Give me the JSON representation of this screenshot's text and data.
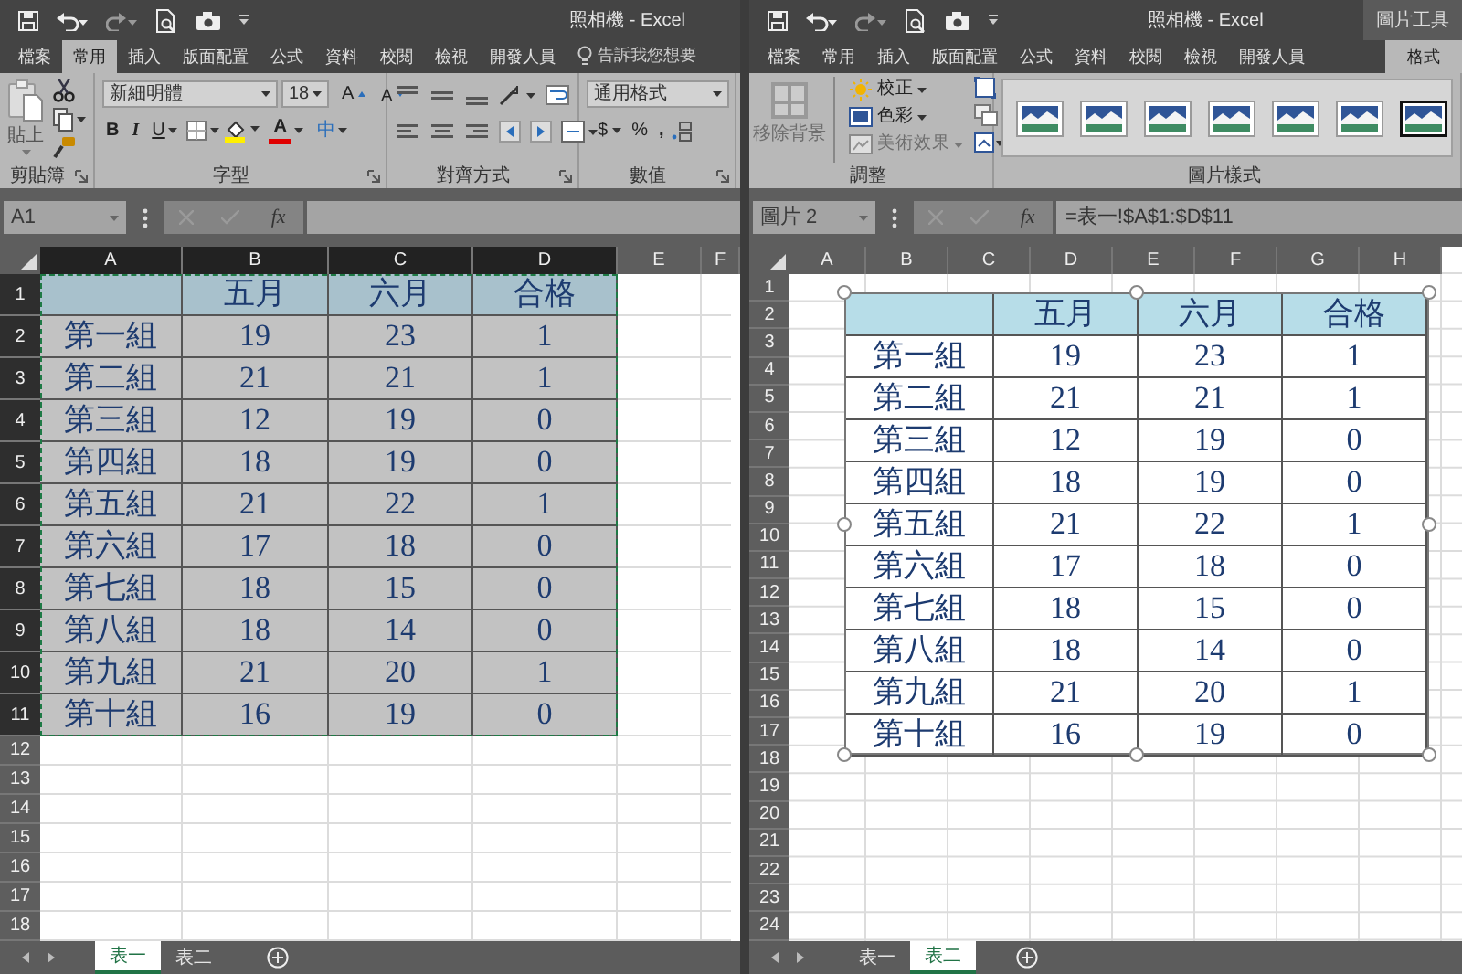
{
  "windows": [
    {
      "title": "照相機 - Excel",
      "ribbon_tabs": [
        {
          "label": "檔案",
          "selected": false
        },
        {
          "label": "常用",
          "selected": true
        },
        {
          "label": "插入",
          "selected": false
        },
        {
          "label": "版面配置",
          "selected": false
        },
        {
          "label": "公式",
          "selected": false
        },
        {
          "label": "資料",
          "selected": false
        },
        {
          "label": "校閱",
          "selected": false
        },
        {
          "label": "檢視",
          "selected": false
        },
        {
          "label": "開發人員",
          "selected": false
        }
      ],
      "tell_me": "告訴我您想要",
      "ribbon": {
        "kind": "home",
        "groups": [
          {
            "label": "剪貼簿",
            "items": [
              {
                "text": "貼上"
              }
            ]
          },
          {
            "label": "字型",
            "items": [
              {
                "text": "新細明體"
              },
              {
                "text": "18"
              },
              {
                "text": "A"
              },
              {
                "text": "A"
              },
              {
                "text": "B"
              },
              {
                "text": "I"
              },
              {
                "text": "U"
              },
              {
                "text": "A"
              },
              {
                "text": "中"
              }
            ]
          },
          {
            "label": "對齊方式"
          },
          {
            "label": "數值",
            "items": [
              {
                "text": "通用格式"
              },
              {
                "text": "$"
              },
              {
                "text": "%"
              },
              {
                "text": ","
              }
            ]
          }
        ]
      },
      "formula_bar": {
        "name_box": "A1",
        "insert_function": "fx"
      },
      "columns": [
        {
          "label": "A",
          "selected": true
        },
        {
          "label": "B",
          "selected": true
        },
        {
          "label": "C",
          "selected": true
        },
        {
          "label": "D",
          "selected": true
        },
        {
          "label": "E",
          "selected": false
        },
        {
          "label": "F",
          "selected": false
        }
      ],
      "rows": [
        {
          "label": "1",
          "selected": true
        },
        {
          "label": "2",
          "selected": true
        },
        {
          "label": "3",
          "selected": true
        },
        {
          "label": "4",
          "selected": true
        },
        {
          "label": "5",
          "selected": true
        },
        {
          "label": "6",
          "selected": true
        },
        {
          "label": "7",
          "selected": true
        },
        {
          "label": "8",
          "selected": true
        },
        {
          "label": "9",
          "selected": true
        },
        {
          "label": "10",
          "selected": true
        },
        {
          "label": "11",
          "selected": true
        },
        {
          "label": "12",
          "selected": false
        },
        {
          "label": "13",
          "selected": false
        },
        {
          "label": "14",
          "selected": false
        },
        {
          "label": "15",
          "selected": false
        },
        {
          "label": "16",
          "selected": false
        },
        {
          "label": "17",
          "selected": false
        },
        {
          "label": "18",
          "selected": false
        }
      ],
      "table": {
        "marquee": true,
        "header": [
          "五月",
          "六月",
          "合格"
        ],
        "rows": [
          {
            "group": "第一組",
            "values": [
              "19",
              "23",
              "1"
            ]
          },
          {
            "group": "第二組",
            "values": [
              "21",
              "21",
              "1"
            ]
          },
          {
            "group": "第三組",
            "values": [
              "12",
              "19",
              "0"
            ]
          },
          {
            "group": "第四組",
            "values": [
              "18",
              "19",
              "0"
            ]
          },
          {
            "group": "第五組",
            "values": [
              "21",
              "22",
              "1"
            ]
          },
          {
            "group": "第六組",
            "values": [
              "17",
              "18",
              "0"
            ]
          },
          {
            "group": "第七組",
            "values": [
              "18",
              "15",
              "0"
            ]
          },
          {
            "group": "第八組",
            "values": [
              "18",
              "14",
              "0"
            ]
          },
          {
            "group": "第九組",
            "values": [
              "21",
              "20",
              "1"
            ]
          },
          {
            "group": "第十組",
            "values": [
              "16",
              "19",
              "0"
            ]
          }
        ]
      },
      "sheet_tabs": [
        {
          "label": "表一",
          "selected": true
        },
        {
          "label": "表二",
          "selected": false
        }
      ]
    },
    {
      "title": "照相機 - Excel",
      "context_tab_group": "圖片工具",
      "ribbon_tabs": [
        {
          "label": "檔案",
          "selected": false
        },
        {
          "label": "常用",
          "selected": false
        },
        {
          "label": "插入",
          "selected": false
        },
        {
          "label": "版面配置",
          "selected": false
        },
        {
          "label": "公式",
          "selected": false
        },
        {
          "label": "資料",
          "selected": false
        },
        {
          "label": "校閱",
          "selected": false
        },
        {
          "label": "檢視",
          "selected": false
        },
        {
          "label": "開發人員",
          "selected": false
        },
        {
          "label": "格式",
          "selected": true
        }
      ],
      "ribbon": {
        "kind": "picture",
        "groups": [
          {
            "label": "調整",
            "items": [
              {
                "text": "移除背景",
                "disabled": true
              },
              {
                "text": "校正",
                "disabled": false
              },
              {
                "text": "色彩",
                "disabled": false
              },
              {
                "text": "美術效果",
                "disabled": true
              }
            ]
          },
          {
            "label": "圖片樣式"
          }
        ]
      },
      "formula_bar": {
        "name_box": "圖片 2",
        "insert_function": "fx",
        "formula": "=表一!$A$1:$D$11"
      },
      "columns": [
        {
          "label": "A",
          "selected": false
        },
        {
          "label": "B",
          "selected": false
        },
        {
          "label": "C",
          "selected": false
        },
        {
          "label": "D",
          "selected": false
        },
        {
          "label": "E",
          "selected": false
        },
        {
          "label": "F",
          "selected": false
        },
        {
          "label": "G",
          "selected": false
        },
        {
          "label": "H",
          "selected": false
        }
      ],
      "rows": [
        {
          "label": "1",
          "selected": false
        },
        {
          "label": "2",
          "selected": false
        },
        {
          "label": "3",
          "selected": false
        },
        {
          "label": "4",
          "selected": false
        },
        {
          "label": "5",
          "selected": false
        },
        {
          "label": "6",
          "selected": false
        },
        {
          "label": "7",
          "selected": false
        },
        {
          "label": "8",
          "selected": false
        },
        {
          "label": "9",
          "selected": false
        },
        {
          "label": "10",
          "selected": false
        },
        {
          "label": "11",
          "selected": false
        },
        {
          "label": "12",
          "selected": false
        },
        {
          "label": "13",
          "selected": false
        },
        {
          "label": "14",
          "selected": false
        },
        {
          "label": "15",
          "selected": false
        },
        {
          "label": "16",
          "selected": false
        },
        {
          "label": "17",
          "selected": false
        },
        {
          "label": "18",
          "selected": false
        },
        {
          "label": "19",
          "selected": false
        },
        {
          "label": "20",
          "selected": false
        },
        {
          "label": "21",
          "selected": false
        },
        {
          "label": "22",
          "selected": false
        },
        {
          "label": "23",
          "selected": false
        },
        {
          "label": "24",
          "selected": false
        }
      ],
      "picture": {
        "selected": true,
        "header": [
          "五月",
          "六月",
          "合格"
        ],
        "rows": [
          {
            "group": "第一組",
            "values": [
              "19",
              "23",
              "1"
            ]
          },
          {
            "group": "第二組",
            "values": [
              "21",
              "21",
              "1"
            ]
          },
          {
            "group": "第三組",
            "values": [
              "12",
              "19",
              "0"
            ]
          },
          {
            "group": "第四組",
            "values": [
              "18",
              "19",
              "0"
            ]
          },
          {
            "group": "第五組",
            "values": [
              "21",
              "22",
              "1"
            ]
          },
          {
            "group": "第六組",
            "values": [
              "17",
              "18",
              "0"
            ]
          },
          {
            "group": "第七組",
            "values": [
              "18",
              "15",
              "0"
            ]
          },
          {
            "group": "第八組",
            "values": [
              "18",
              "14",
              "0"
            ]
          },
          {
            "group": "第九組",
            "values": [
              "21",
              "20",
              "1"
            ]
          },
          {
            "group": "第十組",
            "values": [
              "16",
              "19",
              "0"
            ]
          }
        ]
      },
      "sheet_tabs": [
        {
          "label": "表一",
          "selected": false
        },
        {
          "label": "表二",
          "selected": true
        }
      ]
    }
  ]
}
